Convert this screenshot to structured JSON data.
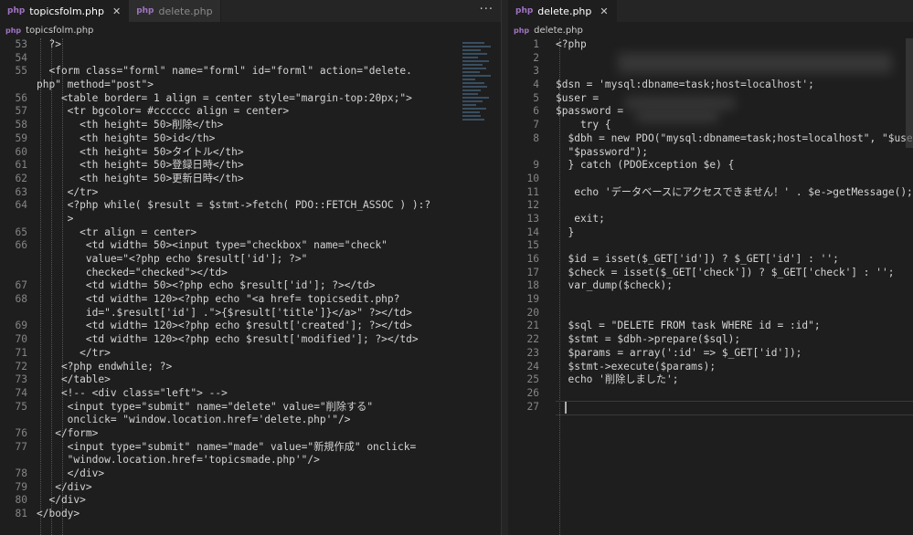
{
  "left_tabs": [
    {
      "label": "topicsfolm.php",
      "icon": "php-icon"
    },
    {
      "label": "delete.php",
      "icon": "php-icon"
    }
  ],
  "left_more": "···",
  "left_breadcrumb": "topicsfolm.php",
  "left_lines": [
    {
      "n": "53",
      "t": "  ?>"
    },
    {
      "n": "54",
      "t": ""
    },
    {
      "n": "55",
      "t": "  <form class=\"forml\" name=\"forml\" id=\"forml\" action=\"delete."
    },
    {
      "n": "",
      "t": "php\" method=\"post\">"
    },
    {
      "n": "56",
      "t": "    <table border= 1 align = center style=\"margin-top:20px;\">"
    },
    {
      "n": "57",
      "t": "     <tr bgcolor= #cccccc align = center>"
    },
    {
      "n": "58",
      "t": "       <th height= 50>削除</th>"
    },
    {
      "n": "59",
      "t": "       <th height= 50>id</th>"
    },
    {
      "n": "60",
      "t": "       <th height= 50>タイトル</th>"
    },
    {
      "n": "61",
      "t": "       <th height= 50>登録日時</th>"
    },
    {
      "n": "62",
      "t": "       <th height= 50>更新日時</th>"
    },
    {
      "n": "63",
      "t": "     </tr>"
    },
    {
      "n": "64",
      "t": "     <?php while( $result = $stmt->fetch( PDO::FETCH_ASSOC ) ):?"
    },
    {
      "n": "",
      "t": "     >"
    },
    {
      "n": "65",
      "t": "       <tr align = center>"
    },
    {
      "n": "66",
      "t": "        <td width= 50><input type=\"checkbox\" name=\"check\""
    },
    {
      "n": "",
      "t": "        value=\"<?php echo $result['id']; ?>\""
    },
    {
      "n": "",
      "t": "        checked=\"checked\"></td>"
    },
    {
      "n": "67",
      "t": "        <td width= 50><?php echo $result['id']; ?></td>"
    },
    {
      "n": "68",
      "t": "        <td width= 120><?php echo \"<a href= topicsedit.php?"
    },
    {
      "n": "",
      "t": "        id=\".$result['id'] .\">{$result['title']}</a>\" ?></td>"
    },
    {
      "n": "69",
      "t": "        <td width= 120><?php echo $result['created']; ?></td>"
    },
    {
      "n": "70",
      "t": "        <td width= 120><?php echo $result['modified']; ?></td>"
    },
    {
      "n": "71",
      "t": "       </tr>"
    },
    {
      "n": "72",
      "t": "    <?php endwhile; ?>"
    },
    {
      "n": "73",
      "t": "    </table>"
    },
    {
      "n": "74",
      "t": "    <!-- <div class=\"left\"> -->"
    },
    {
      "n": "75",
      "t": "     <input type=\"submit\" name=\"delete\" value=\"削除する\""
    },
    {
      "n": "",
      "t": "     onclick= \"window.location.href='delete.php'\"/>"
    },
    {
      "n": "76",
      "t": "   </form>"
    },
    {
      "n": "77",
      "t": "     <input type=\"submit\" name=\"made\" value=\"新規作成\" onclick="
    },
    {
      "n": "",
      "t": "     \"window.location.href='topicsmade.php'\"/>"
    },
    {
      "n": "78",
      "t": "     </div>"
    },
    {
      "n": "79",
      "t": "   </div>"
    },
    {
      "n": "80",
      "t": "  </div>"
    },
    {
      "n": "81",
      "t": "</body>"
    }
  ],
  "right_tabs": [
    {
      "label": "delete.php",
      "icon": "php-icon"
    }
  ],
  "right_breadcrumb": "delete.php",
  "right_lines": [
    {
      "n": "1",
      "t": "<?php"
    },
    {
      "n": "2",
      "t": ""
    },
    {
      "n": "3",
      "t": ""
    },
    {
      "n": "4",
      "t": "$dsn = 'mysql:dbname=task;host=localhost';"
    },
    {
      "n": "5",
      "t": "$user ="
    },
    {
      "n": "6",
      "t": "$password ="
    },
    {
      "n": "7",
      "t": "    try {"
    },
    {
      "n": "8",
      "t": "  $dbh = new PDO(\"mysql:dbname=task;host=localhost\", \"$user\","
    },
    {
      "n": "",
      "t": "  \"$password\");"
    },
    {
      "n": "9",
      "t": "  } catch (PDOException $e) {"
    },
    {
      "n": "10",
      "t": ""
    },
    {
      "n": "11",
      "t": "   echo 'データベースにアクセスできません！' . $e->getMessage();"
    },
    {
      "n": "12",
      "t": ""
    },
    {
      "n": "13",
      "t": "   exit;"
    },
    {
      "n": "14",
      "t": "  }"
    },
    {
      "n": "15",
      "t": ""
    },
    {
      "n": "16",
      "t": "  $id = isset($_GET['id']) ? $_GET['id'] : '';"
    },
    {
      "n": "17",
      "t": "  $check = isset($_GET['check']) ? $_GET['check'] : '';"
    },
    {
      "n": "18",
      "t": "  var_dump($check);"
    },
    {
      "n": "19",
      "t": ""
    },
    {
      "n": "20",
      "t": ""
    },
    {
      "n": "21",
      "t": "  $sql = \"DELETE FROM task WHERE id = :id\";"
    },
    {
      "n": "22",
      "t": "  $stmt = $dbh->prepare($sql);"
    },
    {
      "n": "23",
      "t": "  $params = array(':id' => $_GET['id']);"
    },
    {
      "n": "24",
      "t": "  $stmt->execute($params);"
    },
    {
      "n": "25",
      "t": "  echo '削除しました';"
    },
    {
      "n": "26",
      "t": ""
    },
    {
      "n": "27",
      "t": ""
    }
  ]
}
